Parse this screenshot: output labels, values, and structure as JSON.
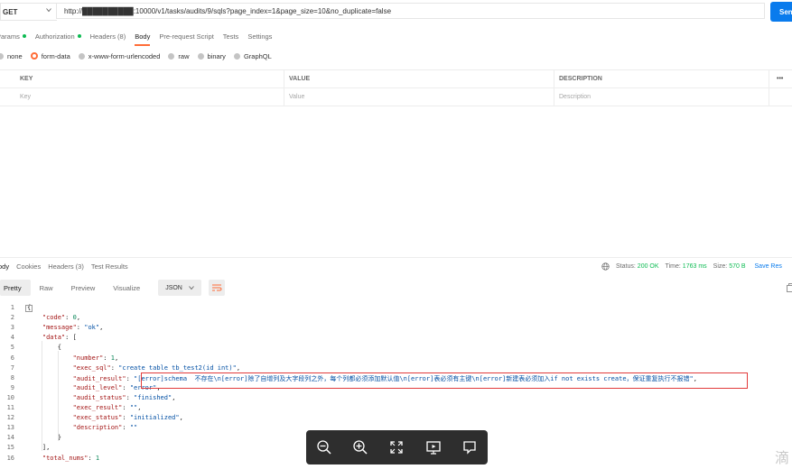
{
  "request": {
    "method": "GET",
    "url": "http://██████████:10000/v1/tasks/audits/9/sqls?page_index=1&page_size=10&no_duplicate=false",
    "send_label": "Send"
  },
  "request_tabs": [
    {
      "label": "Params",
      "dot": true
    },
    {
      "label": "Authorization",
      "dot": true
    },
    {
      "label": "Headers (8)",
      "dot": false
    },
    {
      "label": "Body",
      "dot": false,
      "active": true
    },
    {
      "label": "Pre-request Script",
      "dot": false
    },
    {
      "label": "Tests",
      "dot": false
    },
    {
      "label": "Settings",
      "dot": false
    }
  ],
  "body_types": [
    {
      "label": "none",
      "selected": false
    },
    {
      "label": "form-data",
      "selected": true
    },
    {
      "label": "x-www-form-urlencoded",
      "selected": false
    },
    {
      "label": "raw",
      "selected": false
    },
    {
      "label": "binary",
      "selected": false
    },
    {
      "label": "GraphQL",
      "selected": false
    }
  ],
  "form_table": {
    "headers": {
      "key": "KEY",
      "value": "VALUE",
      "description": "DESCRIPTION",
      "more": "•••"
    },
    "placeholders": {
      "key": "Key",
      "value": "Value",
      "description": "Description"
    }
  },
  "response": {
    "tabs": [
      "Body",
      "Cookies",
      "Headers (3)",
      "Test Results"
    ],
    "status_label": "Status:",
    "status_value": "200 OK",
    "time_label": "Time:",
    "time_value": "1763 ms",
    "size_label": "Size:",
    "size_value": "570 B",
    "save_label": "Save Res",
    "view_tabs": [
      "Pretty",
      "Raw",
      "Preview",
      "Visualize"
    ],
    "format": "JSON"
  },
  "code_lines": [
    "{",
    "    \"code\": 0,",
    "    \"message\": \"ok\",",
    "    \"data\": [",
    "        {",
    "            \"number\": 1,",
    "            \"exec_sql\": \"create table tb_test2(id int)\",",
    "            \"audit_result\": \"[error]schema  不存在\\n[error]除了自增列及大字段列之外，每个列都必须添加默认值\\n[error]表必须有主键\\n[error]新建表必须加入if not exists create，保证重复执行不报错\",",
    "            \"audit_level\": \"error\",",
    "            \"audit_status\": \"finished\",",
    "            \"exec_result\": \"\",",
    "            \"exec_status\": \"initialized\",",
    "            \"description\": \"\"",
    "        }",
    "    ],",
    "    \"total_nums\": 1"
  ],
  "watermark": "滴",
  "colors": {
    "accent": "#ff6c37",
    "send": "#097bed",
    "status_ok": "#0cbb52",
    "highlight_box": "#e23b3b",
    "viewer_bg": "#2e2e2e"
  }
}
